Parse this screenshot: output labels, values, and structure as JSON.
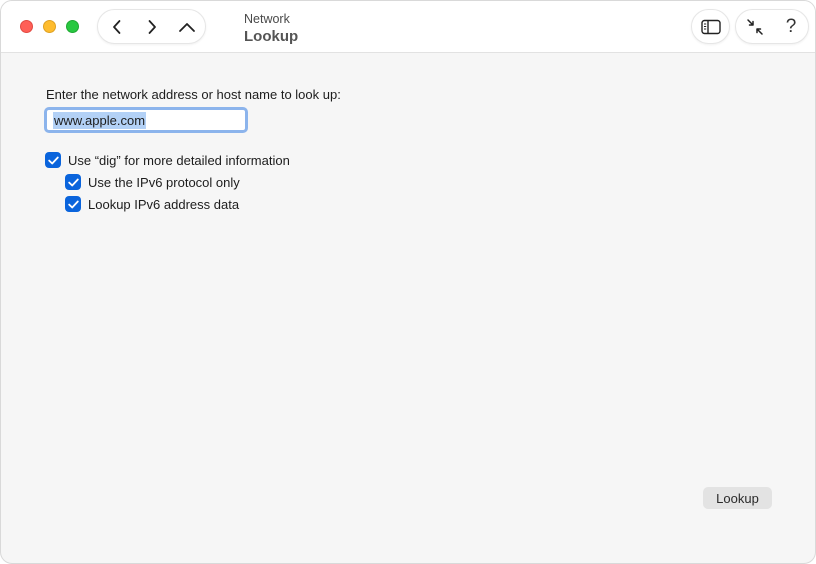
{
  "window": {
    "title_sub": "Network",
    "title_main": "Lookup"
  },
  "toolbar": {
    "back_icon": "chevron-left-icon",
    "forward_icon": "chevron-right-icon",
    "up_icon": "chevron-up-icon",
    "sidebar_icon": "sidebar-toggle-icon",
    "collapse_icon": "collapse-arrows-icon",
    "help_label": "?"
  },
  "form": {
    "prompt": "Enter the network address or host name to look up:",
    "host_value": "www.apple.com",
    "options": {
      "dig_label": "Use “dig” for more detailed information",
      "dig_checked": true,
      "ipv6_label": "Use the IPv6 protocol only",
      "ipv6_checked": true,
      "lookup_ipv6_label": "Lookup IPv6 address data",
      "lookup_ipv6_checked": true
    },
    "lookup_button_label": "Lookup"
  },
  "colors": {
    "accent": "#0a64dc",
    "focus_ring": "#8cb4ec",
    "selection": "#b3d1f6",
    "close": "#ff5f57",
    "minimize": "#febc2e",
    "zoom": "#28c840"
  }
}
